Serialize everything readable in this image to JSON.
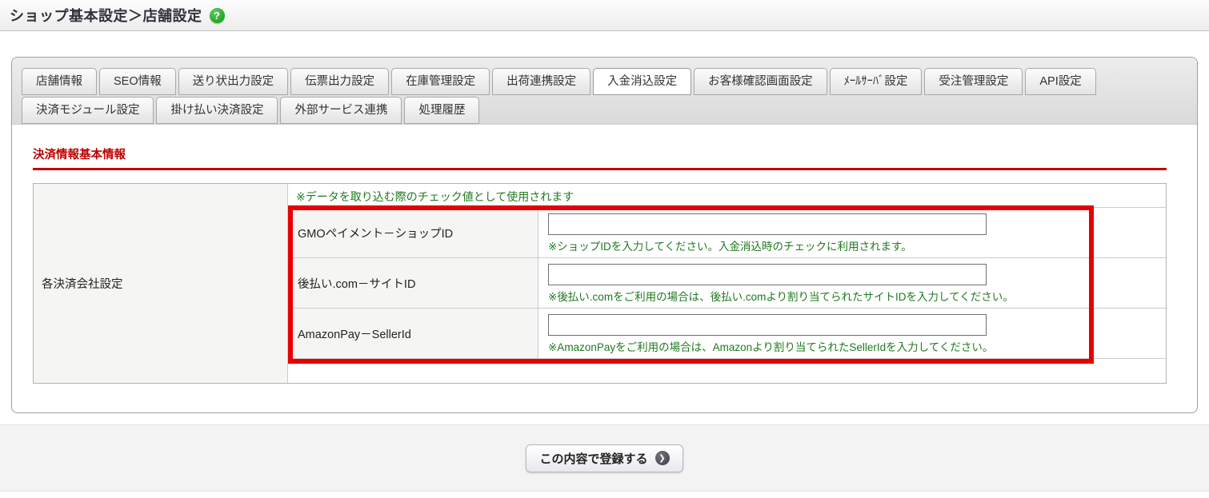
{
  "page": {
    "title": "ショップ基本設定＞店舗設定"
  },
  "tabs": {
    "row1": [
      {
        "label": "店舗情報",
        "active": false
      },
      {
        "label": "SEO情報",
        "active": false
      },
      {
        "label": "送り状出力設定",
        "active": false
      },
      {
        "label": "伝票出力設定",
        "active": false
      },
      {
        "label": "在庫管理設定",
        "active": false
      },
      {
        "label": "出荷連携設定",
        "active": false
      },
      {
        "label": "入金消込設定",
        "active": true
      },
      {
        "label": "お客様確認画面設定",
        "active": false
      },
      {
        "label": "ﾒｰﾙｻｰﾊﾞ設定",
        "active": false
      },
      {
        "label": "受注管理設定",
        "active": false
      },
      {
        "label": "API設定",
        "active": false
      }
    ],
    "row2": [
      {
        "label": "決済モジュール設定",
        "active": false
      },
      {
        "label": "掛け払い決済設定",
        "active": false
      },
      {
        "label": "外部サービス連携",
        "active": false
      },
      {
        "label": "処理履歴",
        "active": false
      }
    ]
  },
  "section": {
    "title": "決済情報基本情報"
  },
  "table": {
    "group_label": "各決済会社設定",
    "top_note": "※データを取り込む際のチェック値として使用されます",
    "fields": [
      {
        "key": "gmo-payment-shop-id",
        "label": "GMOペイメント－ショップID",
        "value": "",
        "note": "※ショップIDを入力してください。入金消込時のチェックに利用されます。"
      },
      {
        "key": "atobarai-com-site-id",
        "label": "後払い.com－サイトID",
        "value": "",
        "note": "※後払い.comをご利用の場合は、後払い.comより割り当てられたサイトIDを入力してください。"
      },
      {
        "key": "amazonpay-seller-id",
        "label": "AmazonPay－SellerId",
        "value": "",
        "note": "※AmazonPayをご利用の場合は、Amazonより割り当てられたSellerIdを入力してください。"
      }
    ]
  },
  "footer": {
    "submit_label": "この内容で登録する"
  },
  "icons": {
    "help": "question-mark-icon",
    "submit_arrow": "arrow-right-circle-icon"
  },
  "colors": {
    "section_red": "#c00000",
    "highlight_red": "#e80000",
    "note_green": "#1f7a1f"
  }
}
